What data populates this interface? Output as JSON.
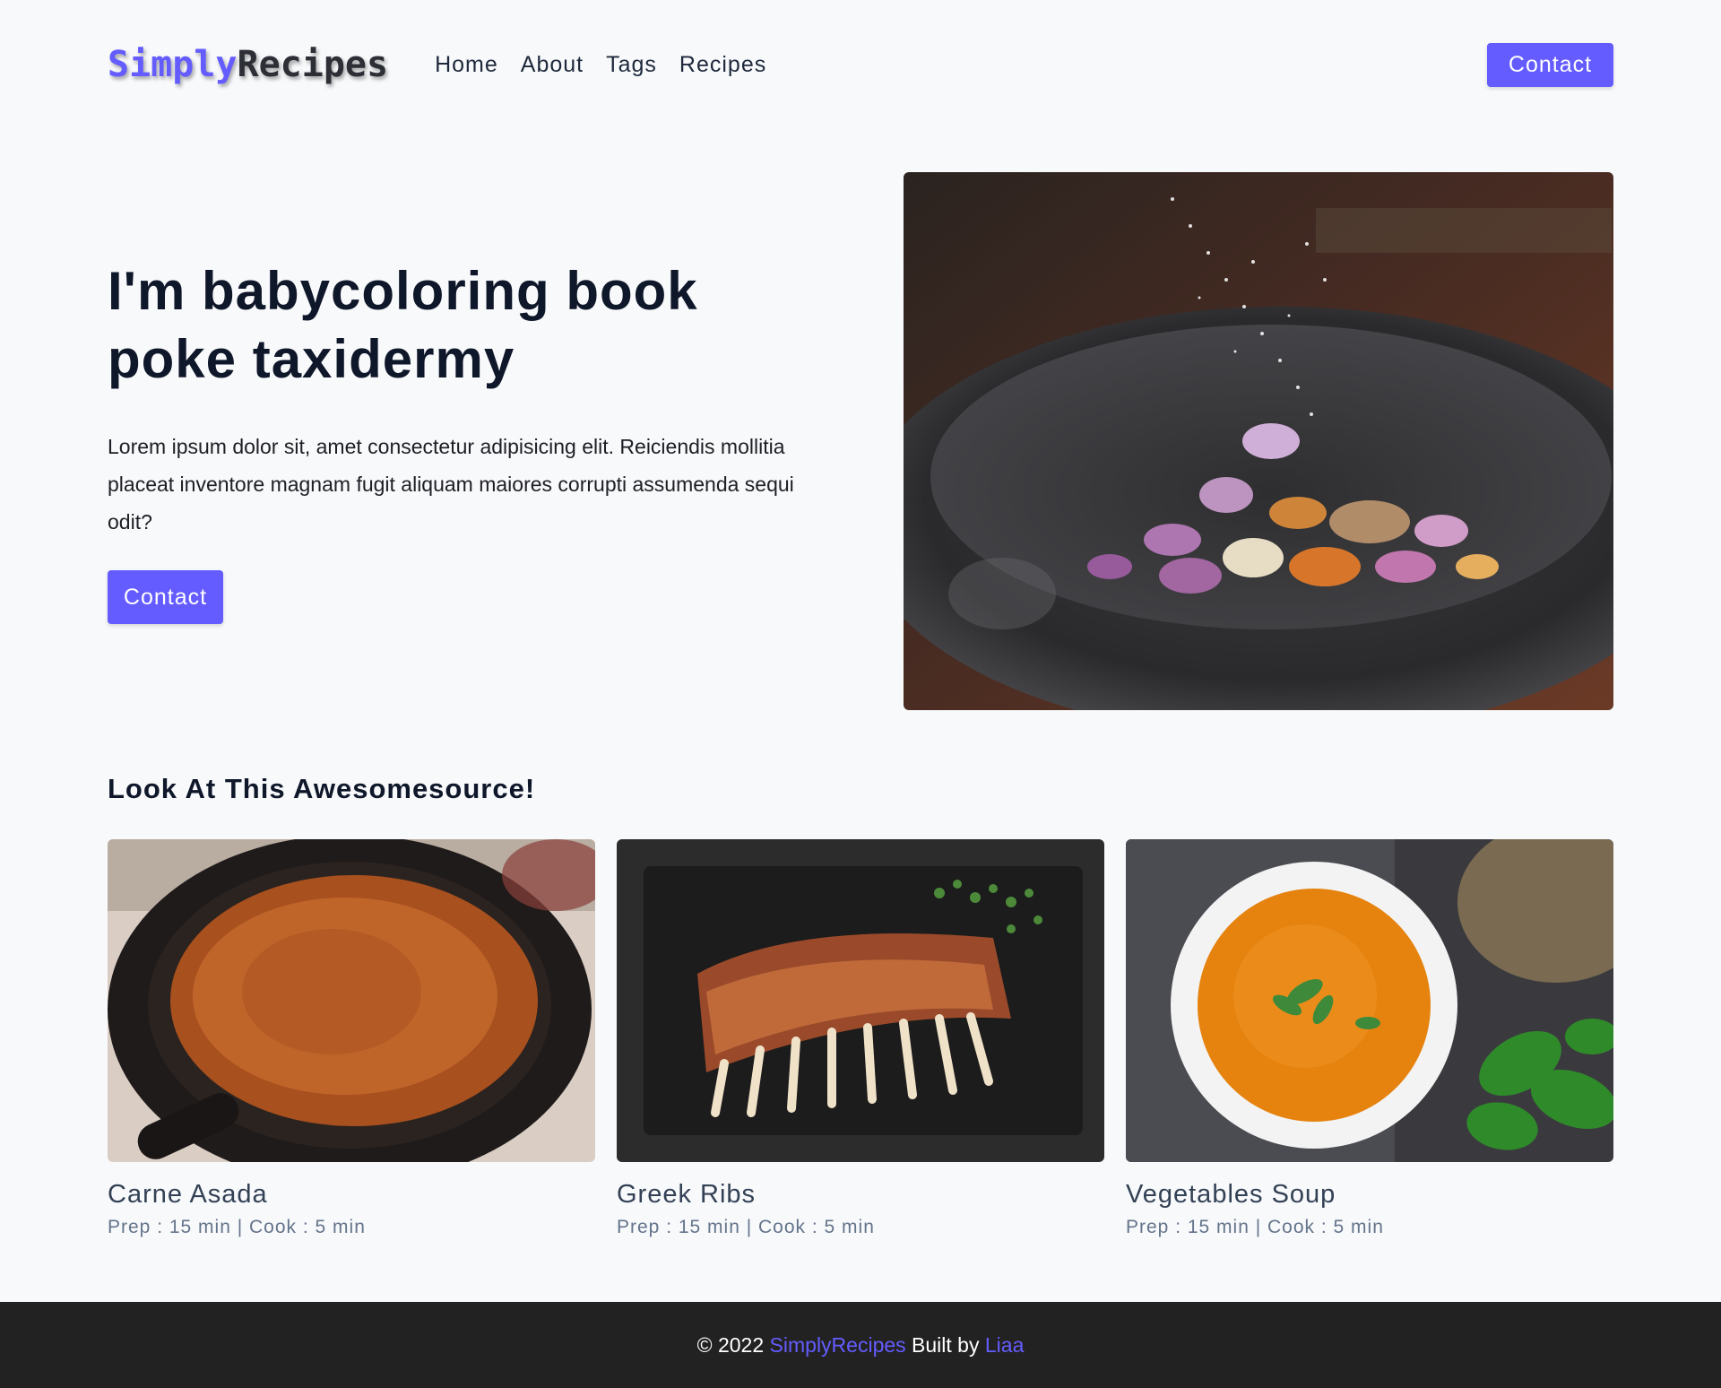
{
  "nav": {
    "logo_part1": "Simply",
    "logo_part2": "Recipes",
    "links": [
      "Home",
      "About",
      "Tags",
      "Recipes"
    ],
    "contact_label": "Contact"
  },
  "hero": {
    "title": "I'm babycoloring book poke taxidermy",
    "text": "Lorem ipsum dolor sit, amet consectetur adipisicing elit. Reiciendis mollitia placeat inventore magnam fugit aliquam maiores corrupti assumenda sequi odit?",
    "button_label": "Contact",
    "image": "mortar-bowl-with-onions-and-spices"
  },
  "section": {
    "title": "Look At This Awesomesource!"
  },
  "recipes": [
    {
      "name": "Carne Asada",
      "meta": "Prep : 15 min | Cook : 5 min",
      "image": "pan-with-minced-meat"
    },
    {
      "name": "Greek Ribs",
      "meta": "Prep : 15 min | Cook : 5 min",
      "image": "grilled-ribs-on-slate"
    },
    {
      "name": "Vegetables Soup",
      "meta": "Prep : 15 min | Cook : 5 min",
      "image": "orange-soup-bowl"
    }
  ],
  "footer": {
    "prefix": "© 2022 ",
    "brand": "SimplyRecipes",
    "middle": " Built by ",
    "author": "Liaa"
  },
  "colors": {
    "accent": "#645cff",
    "background": "#f8f9fb",
    "footer_bg": "#222222"
  }
}
